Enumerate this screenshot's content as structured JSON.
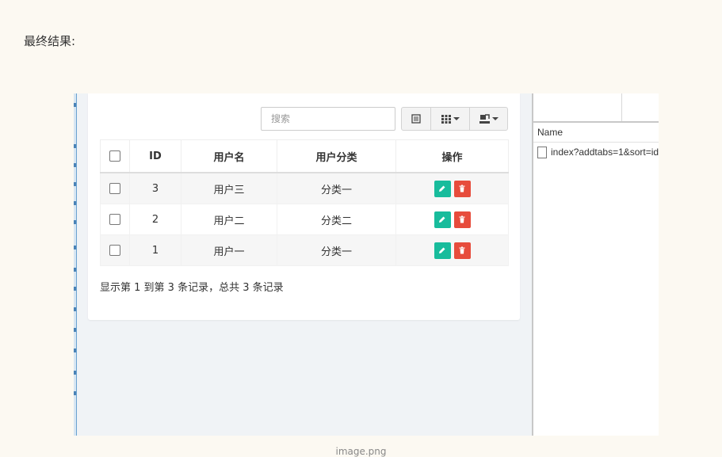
{
  "heading": "最终结果:",
  "caption": "image.png",
  "toolbar": {
    "search_placeholder": "搜索",
    "icons": [
      "list-icon",
      "columns-icon",
      "export-icon"
    ]
  },
  "table": {
    "columns": [
      "ID",
      "用户名",
      "用户分类",
      "操作"
    ],
    "rows": [
      {
        "id": "3",
        "username": "用户三",
        "category": "分类一"
      },
      {
        "id": "2",
        "username": "用户二",
        "category": "分类二"
      },
      {
        "id": "1",
        "username": "用户一",
        "category": "分类一"
      }
    ]
  },
  "pagination": {
    "summary": "显示第 1 到第 3 条记录，总共 3 条记录"
  },
  "devtools": {
    "column_header": "Name",
    "request_name": "index?addtabs=1&sort=id"
  },
  "colors": {
    "edit": "#18bc9c",
    "delete": "#e74c3c",
    "background": "#fcf9f2"
  }
}
